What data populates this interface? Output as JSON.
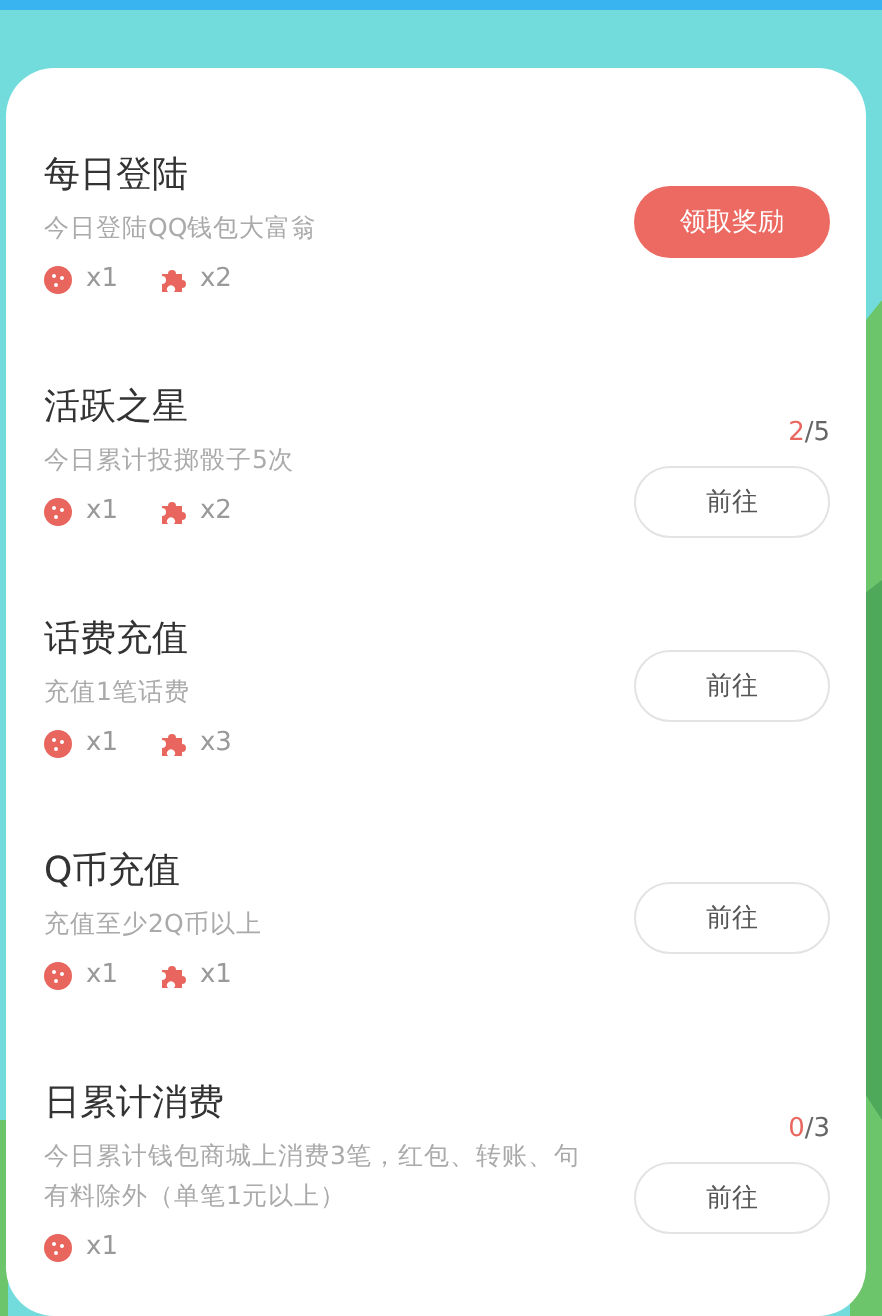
{
  "tasks": [
    {
      "title": "每日登陆",
      "description": "今日登陆QQ钱包大富翁",
      "rewards": [
        {
          "kind": "dice",
          "count": "x1"
        },
        {
          "kind": "puzzle",
          "count": "x2"
        }
      ],
      "button": {
        "label": "领取奖励",
        "kind": "primary"
      }
    },
    {
      "title": "活跃之星",
      "description": "今日累计投掷骰子5次",
      "progress": {
        "done": "2",
        "total": "/5"
      },
      "rewards": [
        {
          "kind": "dice",
          "count": "x1"
        },
        {
          "kind": "puzzle",
          "count": "x2"
        }
      ],
      "button": {
        "label": "前往",
        "kind": "outline"
      }
    },
    {
      "title": "话费充值",
      "description": "充值1笔话费",
      "rewards": [
        {
          "kind": "dice",
          "count": "x1"
        },
        {
          "kind": "puzzle",
          "count": "x3"
        }
      ],
      "button": {
        "label": "前往",
        "kind": "outline"
      }
    },
    {
      "title": "Q币充值",
      "description": "充值至少2Q币以上",
      "rewards": [
        {
          "kind": "dice",
          "count": "x1"
        },
        {
          "kind": "puzzle",
          "count": "x1"
        }
      ],
      "button": {
        "label": "前往",
        "kind": "outline"
      }
    },
    {
      "title": "日累计消费",
      "description": "今日累计钱包商城上消费3笔，红包、转账、句有料除外（单笔1元以上）",
      "progress": {
        "done": "0",
        "total": "/3"
      },
      "rewards": [
        {
          "kind": "dice",
          "count": "x1"
        }
      ],
      "button": {
        "label": "前往",
        "kind": "outline"
      }
    }
  ]
}
